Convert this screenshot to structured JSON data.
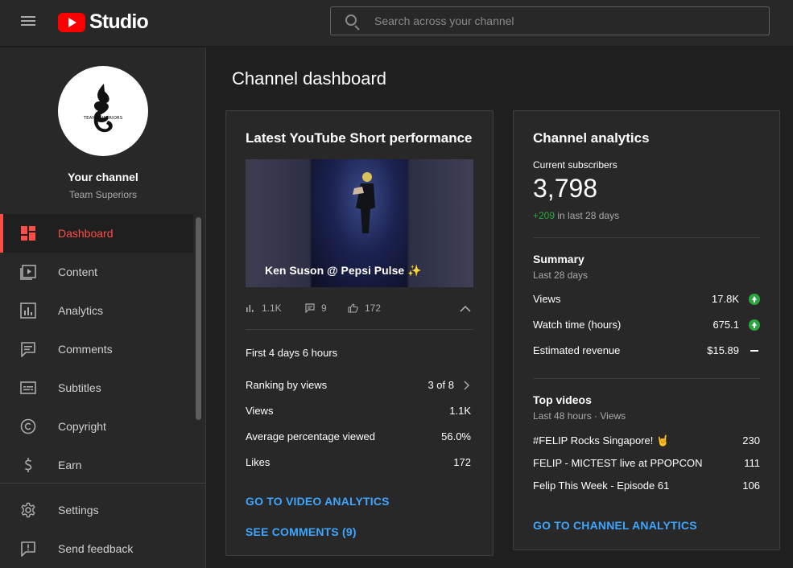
{
  "header": {
    "logo_text": "Studio",
    "search_placeholder": "Search across your channel"
  },
  "sidebar": {
    "your_channel": "Your channel",
    "channel_name": "Team Superiors",
    "avatar_text": "TEAM SUPERIORS",
    "items": [
      {
        "label": "Dashboard",
        "icon": "dashboard-icon",
        "active": true
      },
      {
        "label": "Content",
        "icon": "content-icon"
      },
      {
        "label": "Analytics",
        "icon": "analytics-icon"
      },
      {
        "label": "Comments",
        "icon": "comments-icon"
      },
      {
        "label": "Subtitles",
        "icon": "subtitles-icon"
      },
      {
        "label": "Copyright",
        "icon": "copyright-icon"
      },
      {
        "label": "Earn",
        "icon": "earn-icon"
      }
    ],
    "bottom_items": [
      {
        "label": "Settings",
        "icon": "gear-icon"
      },
      {
        "label": "Send feedback",
        "icon": "feedback-icon"
      }
    ]
  },
  "main": {
    "title": "Channel dashboard",
    "short_card": {
      "title": "Latest YouTube Short performance",
      "video_title": "Ken Suson @ Pepsi Pulse ✨",
      "stats": {
        "views": "1.1K",
        "comments": "9",
        "likes": "172"
      },
      "period": "First 4 days 6 hours",
      "rows": [
        {
          "label": "Ranking by views",
          "value": "3 of 8"
        },
        {
          "label": "Views",
          "value": "1.1K"
        },
        {
          "label": "Average percentage viewed",
          "value": "56.0%"
        },
        {
          "label": "Likes",
          "value": "172"
        }
      ],
      "link_analytics": "GO TO VIDEO ANALYTICS",
      "link_comments": "SEE COMMENTS (9)"
    },
    "analytics_card": {
      "title": "Channel analytics",
      "subs_label": "Current subscribers",
      "subs_value": "3,798",
      "subs_delta": "+209",
      "subs_delta_suffix": " in last 28 days",
      "summary_title": "Summary",
      "summary_period": "Last 28 days",
      "summary_rows": [
        {
          "label": "Views",
          "value": "17.8K",
          "trend": "up"
        },
        {
          "label": "Watch time (hours)",
          "value": "675.1",
          "trend": "up"
        },
        {
          "label": "Estimated revenue",
          "value": "$15.89",
          "trend": "flat"
        }
      ],
      "top_title": "Top videos",
      "top_period": "Last 48 hours · Views",
      "top_rows": [
        {
          "label": "#FELIP Rocks Singapore! 🤘",
          "value": "230"
        },
        {
          "label": "FELIP - MICTEST live at PPOPCON",
          "value": "111"
        },
        {
          "label": "Felip This Week - Episode 61",
          "value": "106"
        }
      ],
      "link": "GO TO CHANNEL ANALYTICS"
    }
  },
  "colors": {
    "accent_red": "#ff4e45",
    "link_blue": "#3ea6ff",
    "up_green": "#2ba640",
    "brand_red": "#ff0000"
  }
}
